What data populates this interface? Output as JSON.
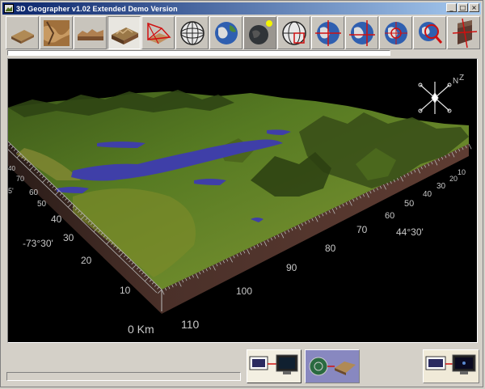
{
  "window": {
    "title": "3D Geographer v1.02 Extended Demo Version",
    "minimize_glyph": "_",
    "maximize_glyph": "□",
    "close_glyph": "×"
  },
  "toolbar": [
    {
      "name": "view-flat-terrain",
      "icon": "flat-terrain-icon"
    },
    {
      "name": "view-relief-map",
      "icon": "relief-map-icon"
    },
    {
      "name": "view-terrain-profile",
      "icon": "terrain-profile-icon"
    },
    {
      "name": "view-3d-block",
      "icon": "3d-block-icon",
      "active": true
    },
    {
      "name": "perspective-frame",
      "icon": "perspective-frame-icon"
    },
    {
      "name": "globe-grid",
      "icon": "globe-grid-icon"
    },
    {
      "name": "globe-earth",
      "icon": "earth-globe-icon"
    },
    {
      "name": "globe-sun-light",
      "icon": "sun-light-globe-icon"
    },
    {
      "name": "globe-selection",
      "icon": "globe-selection-icon"
    },
    {
      "name": "globe-crosshair",
      "icon": "globe-crosshair-icon"
    },
    {
      "name": "globe-position",
      "icon": "globe-position-icon"
    },
    {
      "name": "globe-target",
      "icon": "globe-target-icon"
    },
    {
      "name": "globe-zoom",
      "icon": "globe-zoom-icon"
    },
    {
      "name": "rotate-block",
      "icon": "rotate-block-icon"
    }
  ],
  "scene": {
    "left_scale_labels": [
      "10",
      "20",
      "30",
      "40",
      "50",
      "60",
      "70",
      "80",
      "90",
      "100",
      "110"
    ],
    "right_scale_labels": [
      "10",
      "20",
      "30",
      "40",
      "50",
      "60",
      "70",
      "80",
      "90",
      "100",
      "110"
    ],
    "partial_left_labels": [
      "70",
      "40",
      "60",
      "50"
    ],
    "partial_right_labels": [
      "10",
      "20",
      "30",
      "40",
      "50",
      "60",
      "70"
    ],
    "origin_label": "0 Km",
    "longitude_label": "-73°30'",
    "latitude_label": "44°30'",
    "minute_mark": "5'",
    "north_label": "N",
    "z_label": "Z"
  },
  "colors": {
    "title_start": "#0a246a",
    "title_end": "#a6caf0",
    "terrain_green": "#4f6e1c",
    "water_blue": "#3f3fa8",
    "block_side": "#4a3029"
  }
}
